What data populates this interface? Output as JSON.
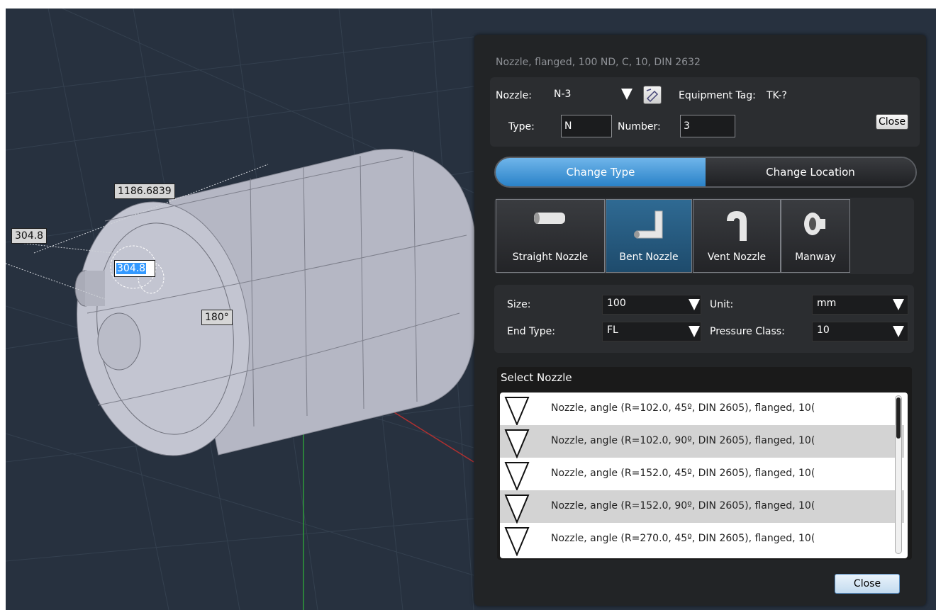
{
  "viewport": {
    "dimension_length": "1186.6839",
    "dimension_offset": "304.8",
    "dimension_input_value": "304.8",
    "dimension_angle": "180°"
  },
  "panel": {
    "caption": "Nozzle, flanged, 100 ND, C, 10, DIN 2632",
    "nozzle_label": "Nozzle:",
    "nozzle_value": "N-3",
    "equipment_tag_label": "Equipment Tag:",
    "equipment_tag_value": "TK-?",
    "type_label": "Type:",
    "type_value": "N",
    "number_label": "Number:",
    "number_value": "3",
    "close_small_label": "Close",
    "tabs": [
      {
        "label": "Change Type",
        "active": true
      },
      {
        "label": "Change Location",
        "active": false
      }
    ],
    "nozzle_types": [
      {
        "label": "Straight Nozzle",
        "icon": "straight-nozzle-icon"
      },
      {
        "label": "Bent Nozzle",
        "icon": "bent-nozzle-icon",
        "active": true
      },
      {
        "label": "Vent Nozzle",
        "icon": "vent-nozzle-icon"
      },
      {
        "label": "Manway",
        "icon": "manway-icon"
      }
    ],
    "size_label": "Size:",
    "size_value": "100",
    "unit_label": "Unit:",
    "unit_value": "mm",
    "end_type_label": "End Type:",
    "end_type_value": "FL",
    "pressure_class_label": "Pressure Class:",
    "pressure_class_value": "10",
    "select_nozzle_title": "Select Nozzle",
    "nozzle_list": [
      "Nozzle, angle (R=102.0, 45º, DIN 2605), flanged, 10(",
      "Nozzle, angle (R=102.0, 90º, DIN 2605), flanged, 10(",
      "Nozzle, angle (R=152.0, 45º, DIN 2605), flanged, 10(",
      "Nozzle, angle (R=152.0, 90º, DIN 2605), flanged, 10(",
      "Nozzle, angle (R=270.0, 45º, DIN 2605), flanged, 10("
    ],
    "close_label": "Close"
  },
  "colors": {
    "viewport_bg": "#27313f",
    "panel_bg": "#222426",
    "accent_blue": "#2a82c8"
  }
}
